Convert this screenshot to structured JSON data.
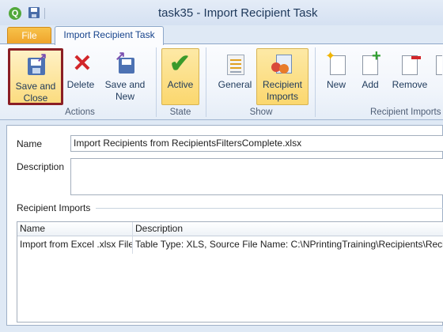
{
  "window": {
    "app_icon_letter": "Q",
    "title": "task35 - Import Recipient Task"
  },
  "tabs": {
    "file": "File",
    "active": "Import Recipient Task"
  },
  "ribbon": {
    "groups": {
      "actions": "Actions",
      "state": "State",
      "show": "Show",
      "recipient_imports": "Recipient Imports"
    },
    "buttons": {
      "save_close_line1": "Save and",
      "save_close_line2": "Close",
      "delete": "Delete",
      "save_new_line1": "Save and",
      "save_new_line2": "New",
      "active": "Active",
      "general": "General",
      "recipient_imports_line1": "Recipient",
      "recipient_imports_line2": "Imports",
      "new": "New",
      "add": "Add",
      "remove": "Remove"
    }
  },
  "form": {
    "name_label": "Name",
    "name_value": "Import Recipients from RecipientsFiltersComplete.xlsx",
    "description_label": "Description",
    "description_value": ""
  },
  "recipient_imports": {
    "section_title": "Recipient Imports",
    "columns": [
      "Name",
      "Description"
    ],
    "rows": [
      [
        "Import from Excel .xlsx File",
        "Table Type: XLS, Source File Name: C:\\NPrintingTraining\\Recipients\\Recip"
      ]
    ]
  }
}
